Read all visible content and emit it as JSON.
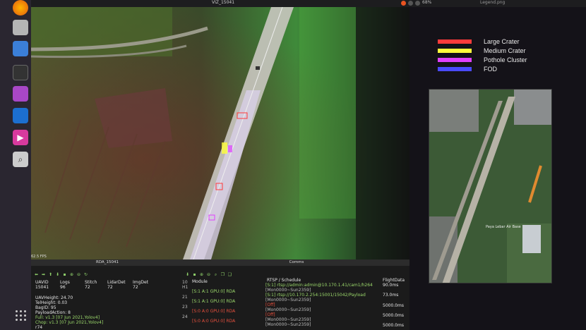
{
  "window": {
    "title": "VIZ_15041",
    "legend_title": "Legend.png",
    "zoom": "68%",
    "fps": "62.5 FPS"
  },
  "colors": {
    "large_crater": "#ff3b3b",
    "medium_crater": "#ffff3b",
    "pothole_cluster": "#e040ff",
    "fod": "#4a4aff"
  },
  "dock": {
    "icons": [
      "firefox-icon",
      "files-icon",
      "document-icon",
      "terminal-icon",
      "app-icon",
      "vscode-icon",
      "media-icon",
      "search-icon",
      "app-grid-icon"
    ]
  },
  "legend": {
    "items": [
      {
        "label": "Large Crater"
      },
      {
        "label": "Medium Crater"
      },
      {
        "label": "Pothole Cluster"
      },
      {
        "label": "FOD"
      }
    ]
  },
  "rda_panel": {
    "title": "RDA_15041",
    "headers": [
      "UAVID",
      "Logs",
      "Stitch",
      "LidarDet",
      "ImgDet"
    ],
    "values": [
      "15041",
      "96",
      "72",
      "72",
      "72"
    ],
    "stats": [
      "UAVHeight: 24.70",
      "TelHeight: 0.03",
      "BagID: 95",
      "PayloadAction: 8"
    ],
    "versions": [
      "Full: v1.3 [07 Jun 2021,Yolov4]",
      "Chop: v1.3 [07 Jun 2021,Yolov4]"
    ],
    "footer": "r74"
  },
  "comms_panel": {
    "title": "Comms",
    "col_module": "Module",
    "col_rtsp": "RTSP / Schedule",
    "col_flight": "FlightData",
    "rows": [
      {
        "id": "10",
        "id2": "H1",
        "module": "",
        "rtsp": "[S:1] rtsp://admin:admin@10.170.1.41/cam1/h264",
        "sched": "[Mon0000~Sun2359]",
        "flight": "90.0ms"
      },
      {
        "id": "21",
        "id2": "",
        "module": "[S:1 A:1 GPU:0] RDA",
        "rtsp": "[S:1] rtsp://10.170.2.254:15001/15042/Payload",
        "sched": "[Mon0000~Sun2359]",
        "flight": "73.0ms"
      },
      {
        "id": "23",
        "id2": "",
        "module": "[S:1 A:1 GPU:0] RDA",
        "rtsp": "[Off]",
        "sched": "[Mon0000~Sun2359]",
        "flight": "5000.0ms"
      },
      {
        "id": "24",
        "id2": "",
        "module": "[S:0 A:0 GPU:0] RDA",
        "rtsp": "[Off]",
        "sched": "[Mon0000~Sun2359]",
        "flight": "5000.0ms"
      },
      {
        "id": "",
        "id2": "",
        "module": "[S:0 A:0 GPU:0] RDA",
        "rtsp": "",
        "sched": "[Mon0000~Sun2359]",
        "flight": "5000.0ms"
      }
    ]
  },
  "minimap": {
    "label": "Paya Lebar Air Base"
  }
}
